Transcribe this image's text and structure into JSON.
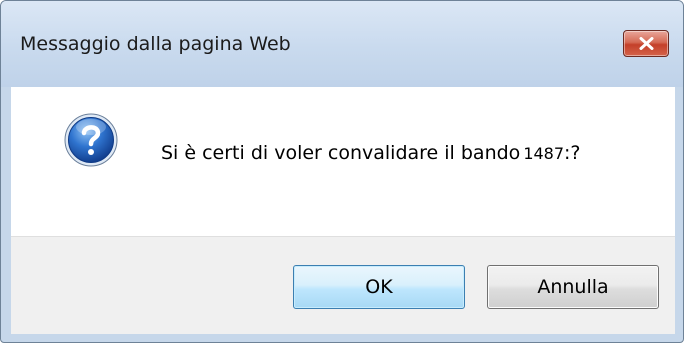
{
  "dialog": {
    "title": "Messaggio dalla pagina Web",
    "message_text": "Si è certi di voler convalidare il bando",
    "message_number": "1487",
    "message_suffix": ":?",
    "icon": "question-icon",
    "close_icon": "close-icon"
  },
  "buttons": {
    "ok_label": "OK",
    "cancel_label": "Annulla"
  },
  "colors": {
    "window_frame": "#c6d7ea",
    "close_button": "#c4402a",
    "icon_blue": "#1d5db8",
    "ok_border": "#3c7fb1"
  }
}
